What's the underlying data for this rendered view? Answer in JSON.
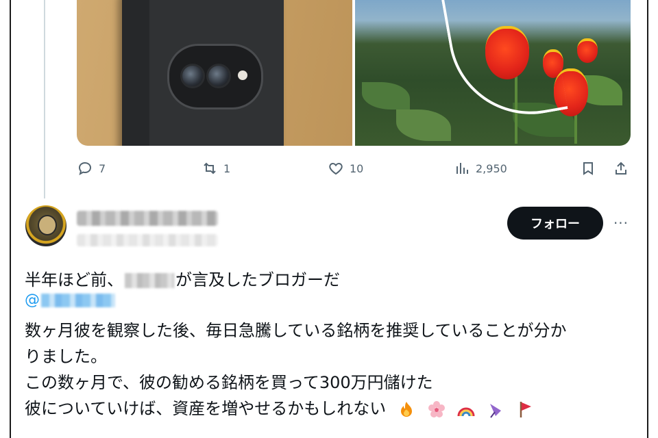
{
  "actions": {
    "reply_count": "7",
    "retweet_count": "1",
    "like_count": "10",
    "view_count": "2,950"
  },
  "post": {
    "follow_label": "フォロー",
    "more_label": "···",
    "line1_before": "半年ほど前、",
    "line1_after": "が言及したブロガーだ",
    "mention_prefix": "@",
    "line2": "数ヶ月彼を観察した後、毎日急騰している銘柄を推奨していることが分か",
    "line3": "りました。",
    "line4": "この数ヶ月で、彼の勧める銘柄を買って300万円儲けた",
    "line5": "彼についていけば、資産を増やせるかもしれない"
  },
  "icons": {
    "emojis": [
      "fire-icon",
      "cherry-blossom-icon",
      "rainbow-icon",
      "umbrella-icon",
      "red-flag-icon"
    ]
  },
  "colors": {
    "follow_bg": "#0f1419",
    "mention": "#1d9bf0",
    "secondary_text": "#536471"
  }
}
